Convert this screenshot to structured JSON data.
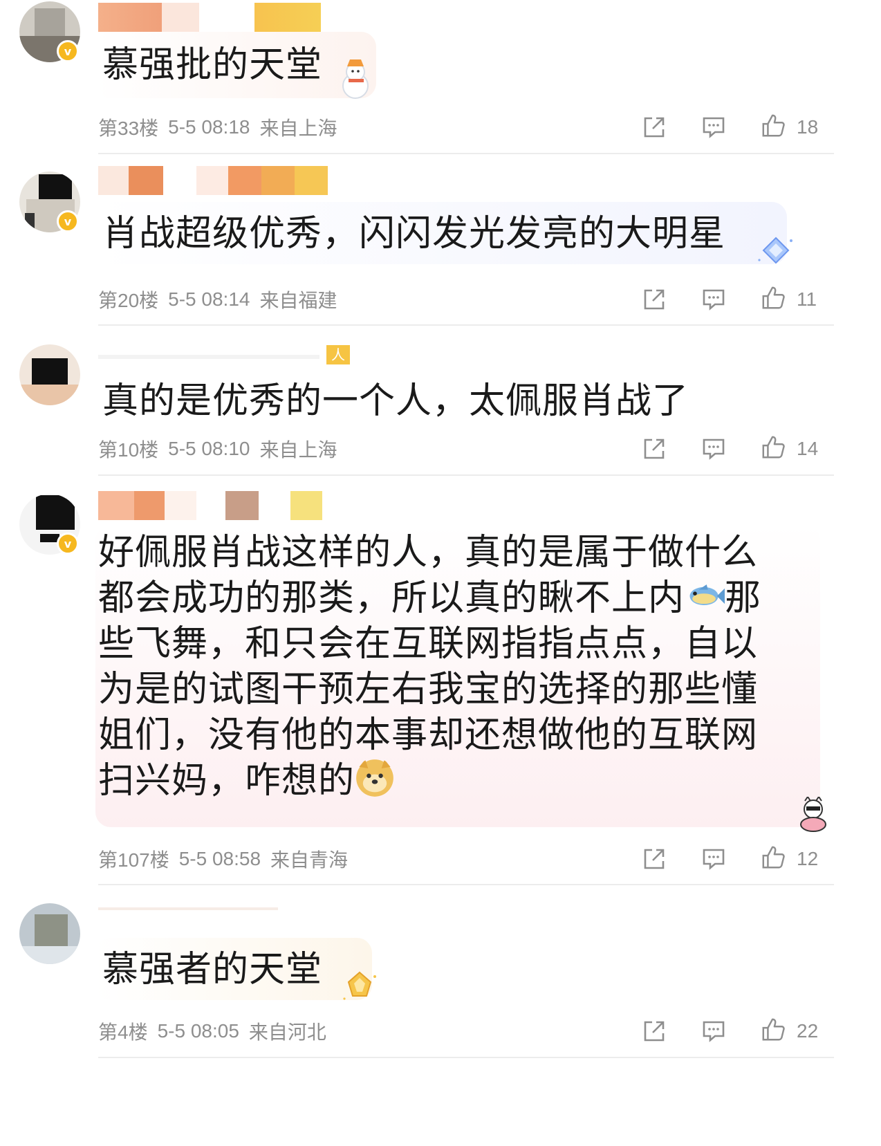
{
  "comments": [
    {
      "text": "慕强批的天堂",
      "floor": "第33楼",
      "date": "5-5 08:18",
      "location": "来自上海",
      "likes": "18"
    },
    {
      "text": "肖战超级优秀，闪闪发光发亮的大明星",
      "floor": "第20楼",
      "date": "5-5 08:14",
      "location": "来自福建",
      "likes": "11"
    },
    {
      "text": "真的是优秀的一个人，太佩服肖战了",
      "floor": "第10楼",
      "date": "5-5 08:10",
      "location": "来自上海",
      "likes": "14",
      "badge_fragment": "人"
    },
    {
      "lines": [
        "好佩服肖战这样的人，真的是属于做什么",
        "都会成功的那类，所以真的瞅不上内",
        "那",
        "些飞舞，和只会在互联网指指点点，自以",
        "为是的试图干预左右我宝的选择的那些懂",
        "姐们，没有他的本事却还想做他的互联网",
        "扫兴妈，咋想的"
      ],
      "emojis": [
        "fish-emoji",
        "doge-emoji"
      ],
      "floor": "第107楼",
      "date": "5-5 08:58",
      "location": "来自青海",
      "likes": "12"
    },
    {
      "text": "慕强者的天堂",
      "floor": "第4楼",
      "date": "5-5 08:05",
      "location": "来自河北",
      "likes": "22"
    }
  ],
  "colors": {
    "meta_gray": "#8e8e8e",
    "divider": "#ececec",
    "vip_badge": "#f6b81f"
  },
  "icons": [
    "share-icon",
    "reply-icon",
    "thumbs-up-icon",
    "verified-badge-icon"
  ]
}
